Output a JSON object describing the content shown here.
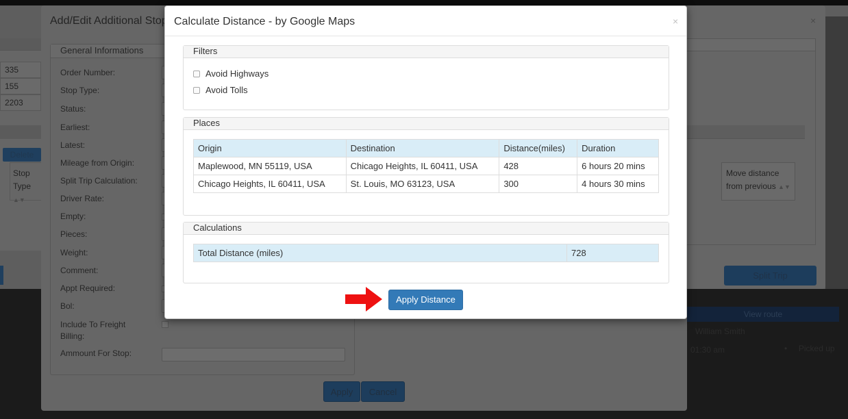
{
  "background": {
    "outer_modal_title": "Add/Edit Additional Stop",
    "outer_close": "×",
    "general_panel_title": "General Informations",
    "left_values": [
      "335",
      "155",
      "2203"
    ],
    "delete_label": "Delete",
    "stop_type_label": "Stop Type",
    "fields": [
      "Order Number:",
      "Stop Type:",
      "Status:",
      "Earliest:",
      "Latest:",
      "Mileage from Origin:",
      "Split Trip Calculation:",
      "Driver Rate:",
      "Empty:",
      "Pieces:",
      "Weight:",
      "Comment:",
      "Appt Required:",
      "Bol:",
      "Include To Freight Billing:",
      "Ammount For Stop:"
    ],
    "move_distance_label": "Move distance from previous",
    "split_trip_label": "Split Trip",
    "apply_label": "Apply",
    "cancel_label": "Cancel",
    "view_route_label": "View route",
    "driver_name": "William Smith",
    "time_text": "01:30 am",
    "status_text": "Picked up"
  },
  "modal": {
    "title": "Calculate Distance - by Google Maps",
    "close": "×",
    "filters": {
      "legend": "Filters",
      "options": [
        {
          "label": "Avoid Highways",
          "checked": false
        },
        {
          "label": "Avoid Tolls",
          "checked": false
        }
      ]
    },
    "places": {
      "legend": "Places",
      "columns": [
        "Origin",
        "Destination",
        "Distance(miles)",
        "Duration"
      ],
      "rows": [
        [
          "Maplewood, MN 55119, USA",
          "Chicago Heights, IL 60411, USA",
          "428",
          "6 hours 20 mins"
        ],
        [
          "Chicago Heights, IL 60411, USA",
          "St. Louis, MO 63123, USA",
          "300",
          "4 hours 30 mins"
        ]
      ]
    },
    "calculations": {
      "legend": "Calculations",
      "total_label": "Total Distance (miles)",
      "total_value": "728"
    },
    "apply_distance_label": "Apply Distance"
  },
  "colors": {
    "primary": "#337ab7",
    "table_header": "#d9edf7",
    "arrow": "#ee1111"
  }
}
